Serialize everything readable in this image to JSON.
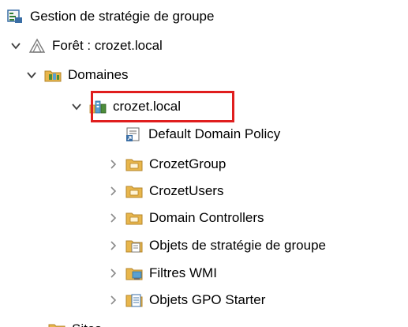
{
  "tree": {
    "root": {
      "label": "Gestion de stratégie de groupe",
      "icon": "gpm-console-icon"
    },
    "forest": {
      "label": "Forêt : crozet.local",
      "icon": "forest-icon",
      "expanded": true
    },
    "domains": {
      "label": "Domaines",
      "icon": "domains-folder-icon",
      "expanded": true
    },
    "domain": {
      "label": "crozet.local",
      "icon": "domain-icon",
      "expanded": true,
      "highlighted": true
    },
    "children": [
      {
        "label": "Default Domain Policy",
        "icon": "gpo-link-icon",
        "expandable": false
      },
      {
        "label": "CrozetGroup",
        "icon": "ou-folder-icon",
        "expandable": true
      },
      {
        "label": "CrozetUsers",
        "icon": "ou-folder-icon",
        "expandable": true
      },
      {
        "label": "Domain Controllers",
        "icon": "ou-folder-icon",
        "expandable": true
      },
      {
        "label": "Objets de stratégie de groupe",
        "icon": "gpo-container-icon",
        "expandable": true
      },
      {
        "label": "Filtres WMI",
        "icon": "wmi-filter-icon",
        "expandable": true
      },
      {
        "label": "Objets GPO Starter",
        "icon": "starter-gpo-icon",
        "expandable": true
      }
    ],
    "partial": {
      "label": "Sites",
      "icon": "sites-folder-icon"
    }
  },
  "colors": {
    "highlight_border": "#e01e1e",
    "chevron": "#404040",
    "folder": "#e8b64c"
  }
}
